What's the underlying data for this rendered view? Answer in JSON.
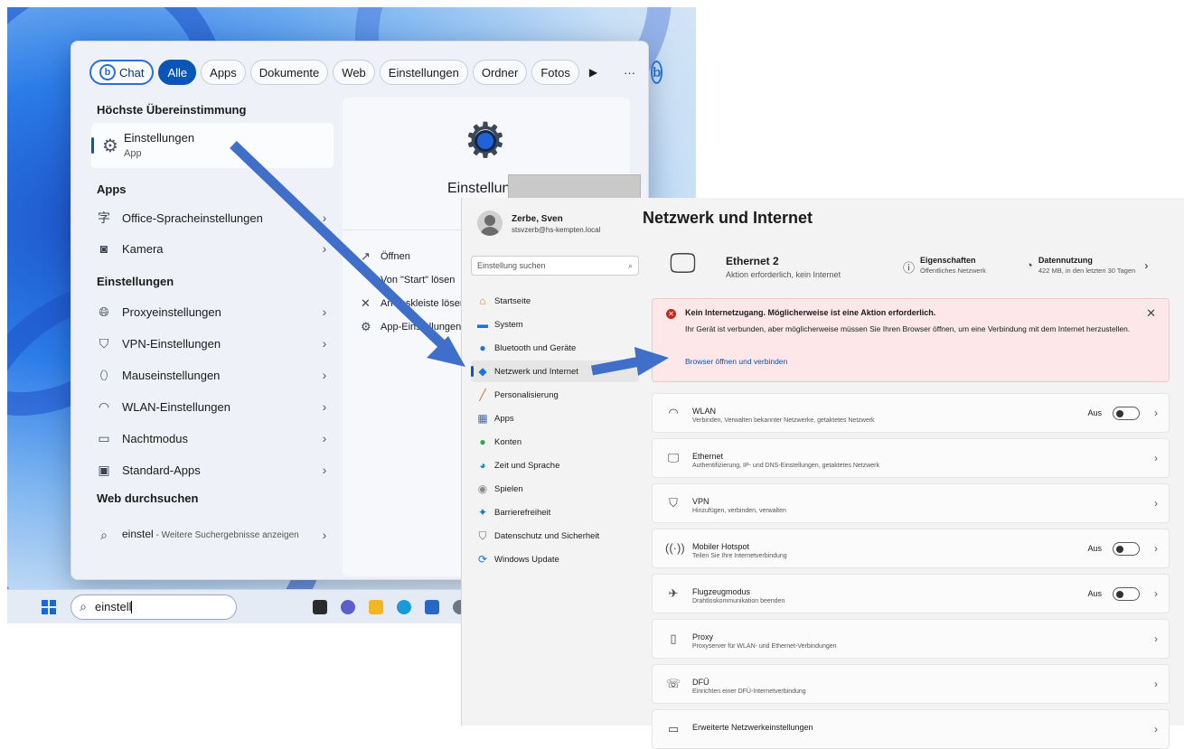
{
  "start_menu": {
    "filters": [
      {
        "label": "Chat"
      },
      {
        "label": "Alle"
      },
      {
        "label": "Apps"
      },
      {
        "label": "Dokumente"
      },
      {
        "label": "Web"
      },
      {
        "label": "Einstellungen"
      },
      {
        "label": "Ordner"
      },
      {
        "label": "Fotos"
      }
    ],
    "more_glyph": "···",
    "sections": {
      "best_match": "Höchste Übereinstimmung",
      "apps": "Apps",
      "settings": "Einstellungen",
      "web": "Web durchsuchen"
    },
    "best_match": {
      "title": "Einstellungen",
      "subtitle": "App"
    },
    "apps": [
      {
        "label": "Office-Spracheinstellungen",
        "icon": "language-icon"
      },
      {
        "label": "Kamera",
        "icon": "camera-icon"
      }
    ],
    "settings": [
      {
        "label": "Proxyeinstellungen",
        "icon": "globe-icon"
      },
      {
        "label": "VPN-Einstellungen",
        "icon": "shield-icon"
      },
      {
        "label": "Mauseinstellungen",
        "icon": "mouse-icon"
      },
      {
        "label": "WLAN-Einstellungen",
        "icon": "wifi-icon"
      },
      {
        "label": "Nachtmodus",
        "icon": "monitor-icon"
      },
      {
        "label": "Standard-Apps",
        "icon": "default-apps-icon"
      }
    ],
    "web": {
      "query": "einstel",
      "rest": " - Weitere Suchergebnisse anzeigen"
    },
    "preview": {
      "title": "Einstellungen",
      "actions": [
        "Öffnen",
        "Von \"Start\" lösen",
        "An Taskleiste lösen",
        "App-Einstellungen"
      ]
    }
  },
  "taskbar": {
    "search_value": "einstell"
  },
  "settings": {
    "user": {
      "name": "Zerbe, Sven",
      "email": "stsvzerb@hs-kempten.local"
    },
    "search_placeholder": "Einstellung suchen",
    "nav": [
      {
        "label": "Startseite",
        "icon": "home-icon",
        "color": "#e8822d"
      },
      {
        "label": "System",
        "icon": "system-icon",
        "color": "#1a73d9"
      },
      {
        "label": "Bluetooth und Geräte",
        "icon": "bluetooth-icon",
        "color": "#1a73d9"
      },
      {
        "label": "Netzwerk und Internet",
        "icon": "network-icon",
        "color": "#1a73d9",
        "selected": true
      },
      {
        "label": "Personalisierung",
        "icon": "brush-icon",
        "color": "#d4693a"
      },
      {
        "label": "Apps",
        "icon": "apps-icon",
        "color": "#4a6fa0"
      },
      {
        "label": "Konten",
        "icon": "accounts-icon",
        "color": "#2fa84f"
      },
      {
        "label": "Zeit und Sprache",
        "icon": "time-language-icon",
        "color": "#1a8fb5"
      },
      {
        "label": "Spielen",
        "icon": "gaming-icon",
        "color": "#8a8a8a"
      },
      {
        "label": "Barrierefreiheit",
        "icon": "accessibility-icon",
        "color": "#1a73d9"
      },
      {
        "label": "Datenschutz und Sicherheit",
        "icon": "privacy-icon",
        "color": "#6a6a6a"
      },
      {
        "label": "Windows Update",
        "icon": "update-icon",
        "color": "#1a73d9"
      }
    ],
    "page_title": "Netzwerk und Internet",
    "ethernet": {
      "name": "Ethernet 2",
      "status": "Aktion erforderlich, kein Internet"
    },
    "properties": {
      "title": "Eigenschaften",
      "sub": "Öffentliches Netzwerk"
    },
    "data_usage": {
      "title": "Datennutzung",
      "sub": "422 MB, in den letzten 30 Tagen"
    },
    "alert": {
      "title": "Kein Internetzugang. Möglicherweise ist eine Aktion erforderlich.",
      "body": "Ihr Gerät ist verbunden, aber möglicherweise müssen Sie Ihren Browser öffnen, um eine Verbindung mit dem Internet herzustellen.",
      "link": "Browser öffnen und verbinden"
    },
    "cards": [
      {
        "title": "WLAN",
        "sub": "Verbinden, Verwalten bekannter Netzwerke, getaktetes Netzwerk",
        "toggle": "Aus",
        "icon": "wifi-icon"
      },
      {
        "title": "Ethernet",
        "sub": "Authentifizierung, IP- und DNS-Einstellungen, getaktetes Netzwerk",
        "icon": "ethernet-icon"
      },
      {
        "title": "VPN",
        "sub": "Hinzufügen, verbinden, verwalten",
        "icon": "vpn-icon"
      },
      {
        "title": "Mobiler Hotspot",
        "sub": "Teilen Sie Ihre Internetverbindung",
        "toggle": "Aus",
        "icon": "hotspot-icon"
      },
      {
        "title": "Flugzeugmodus",
        "sub": "Drahtloskommunikation beenden",
        "toggle": "Aus",
        "icon": "airplane-icon"
      },
      {
        "title": "Proxy",
        "sub": "Proxyserver für WLAN- und Ethernet-Verbindungen",
        "icon": "proxy-icon"
      },
      {
        "title": "DFÜ",
        "sub": "Einrichten einer DFÜ-Internetverbindung",
        "icon": "dialup-icon"
      },
      {
        "title": "Erweiterte Netzwerkeinstellungen",
        "sub": "",
        "icon": "advanced-network-icon"
      }
    ]
  },
  "colors": {
    "accent": "#0a56b8",
    "arrow": "#3f6fc9",
    "alert_bg": "#fde7e9"
  }
}
